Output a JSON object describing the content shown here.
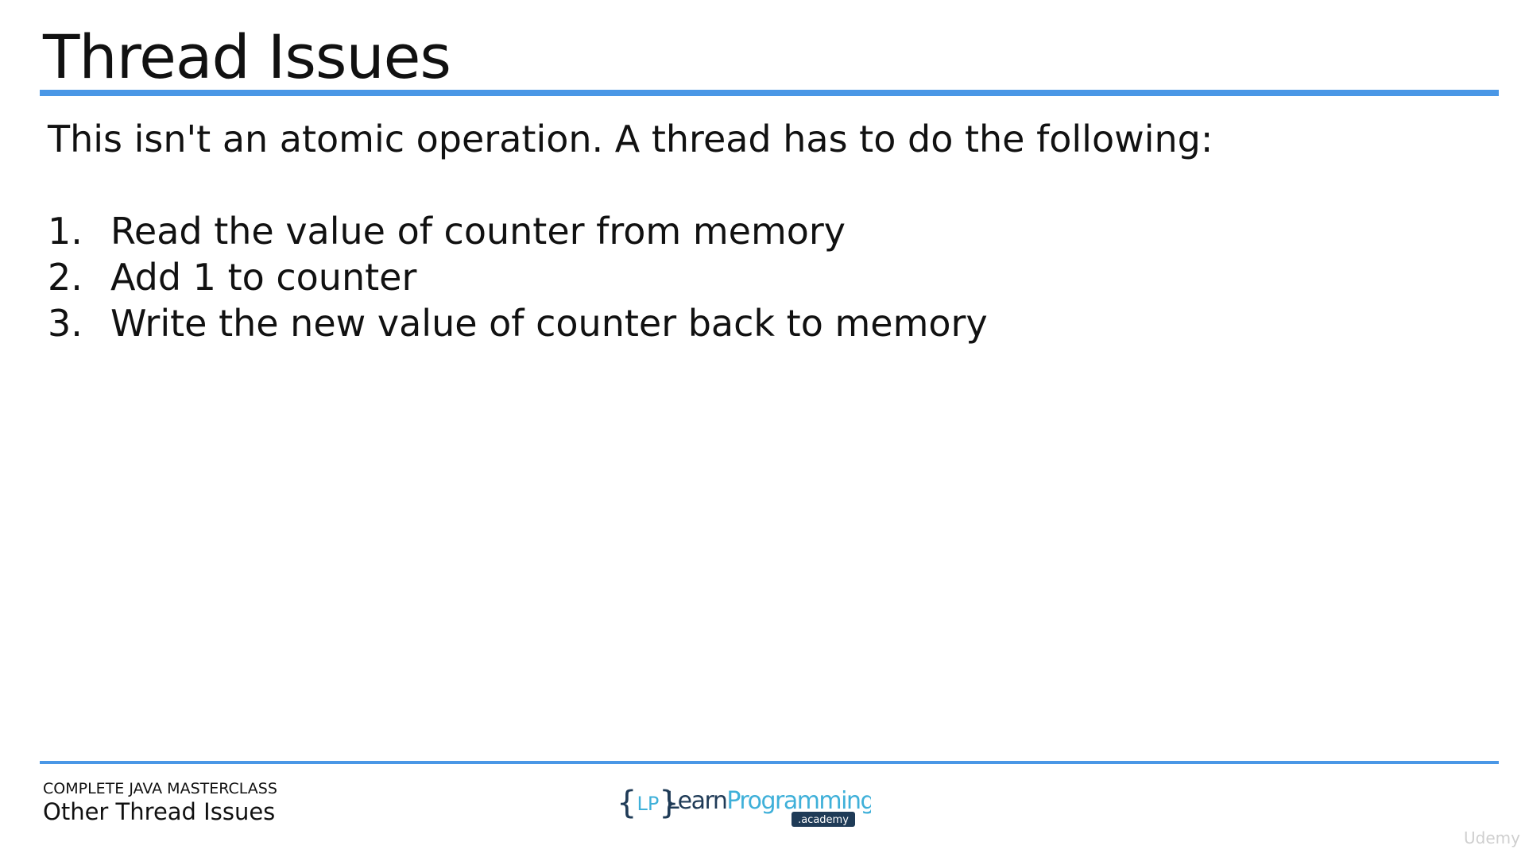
{
  "slide": {
    "title": "Thread Issues",
    "intro": "This isn't an atomic operation. A thread has to do the following:",
    "steps": [
      {
        "num": "1.",
        "text": "Read the value of counter from memory"
      },
      {
        "num": "2.",
        "text": "Add 1 to counter"
      },
      {
        "num": "3.",
        "text": "Write the new value of counter back to memory"
      }
    ]
  },
  "footer": {
    "course": "COMPLETE JAVA MASTERCLASS",
    "lecture": "Other Thread Issues",
    "logo": {
      "brace_text": "{LP}",
      "name_part1": "Learn",
      "name_part2": "Programming",
      "badge": ".academy"
    }
  },
  "watermark": "Udemy",
  "colors": {
    "accent_rule": "#4a97e6",
    "logo_dark": "#1f3b57",
    "logo_light": "#3fb0d9"
  }
}
